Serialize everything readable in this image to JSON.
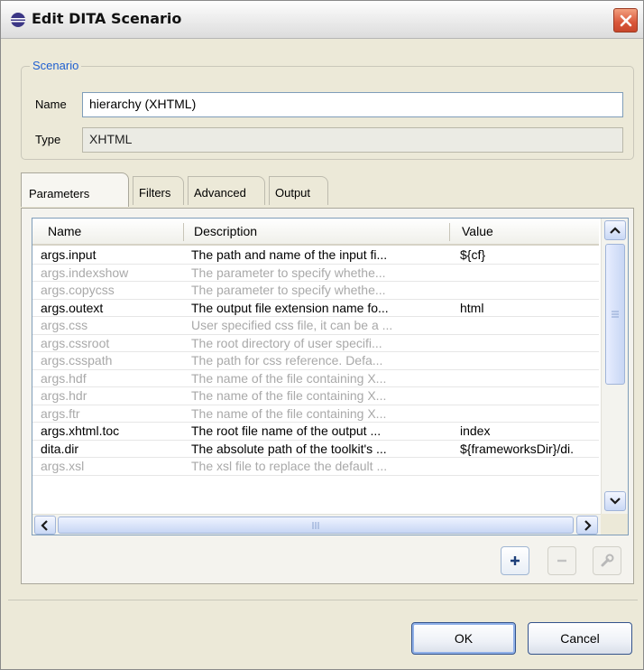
{
  "window": {
    "title": "Edit DITA Scenario"
  },
  "scenario": {
    "legend": "Scenario",
    "name_label": "Name",
    "name_value": "hierarchy (XHTML)",
    "type_label": "Type",
    "type_value": "XHTML"
  },
  "tabs": [
    {
      "label": "Parameters",
      "active": true
    },
    {
      "label": "Filters",
      "active": false
    },
    {
      "label": "Advanced",
      "active": false
    },
    {
      "label": "Output",
      "active": false
    }
  ],
  "table": {
    "columns": [
      "Name",
      "Description",
      "Value"
    ],
    "rows": [
      {
        "name": "args.input",
        "description": "The path and name of the input fi...",
        "value": "${cf}",
        "set": true
      },
      {
        "name": "args.indexshow",
        "description": "The parameter to specify whethe...",
        "value": "",
        "set": false
      },
      {
        "name": "args.copycss",
        "description": "The parameter to specify whethe...",
        "value": "",
        "set": false
      },
      {
        "name": "args.outext",
        "description": "The output file extension name fo...",
        "value": "html",
        "set": true
      },
      {
        "name": "args.css",
        "description": "User specified css file, it can be a ...",
        "value": "",
        "set": false
      },
      {
        "name": "args.cssroot",
        "description": "The root directory of user specifi...",
        "value": "",
        "set": false
      },
      {
        "name": "args.csspath",
        "description": "The path for css reference. Defa...",
        "value": "",
        "set": false
      },
      {
        "name": "args.hdf",
        "description": "The name of the file containing X...",
        "value": "",
        "set": false
      },
      {
        "name": "args.hdr",
        "description": "The name of the file containing X...",
        "value": "",
        "set": false
      },
      {
        "name": "args.ftr",
        "description": "The name of the file containing X...",
        "value": "",
        "set": false
      },
      {
        "name": "args.xhtml.toc",
        "description": "The root file name of the output ...",
        "value": "index",
        "set": true
      },
      {
        "name": "dita.dir",
        "description": "The absolute path of the toolkit's ...",
        "value": "${frameworksDir}/di.",
        "set": true
      },
      {
        "name": "args.xsl",
        "description": "The xsl file to replace the default ...",
        "value": "",
        "set": false
      }
    ],
    "vscroll_position": 0.0,
    "hscroll_position": 0.0
  },
  "icons": {
    "app": "eclipse-icon",
    "close": "close-icon",
    "add": "plus-icon",
    "remove": "minus-icon",
    "edit": "wrench-icon"
  },
  "buttons": {
    "ok": "OK",
    "cancel": "Cancel"
  },
  "colors": {
    "legend": "#1f5fd0",
    "inactive_text": "#a9a9a9",
    "close_button": "#d9573a"
  }
}
